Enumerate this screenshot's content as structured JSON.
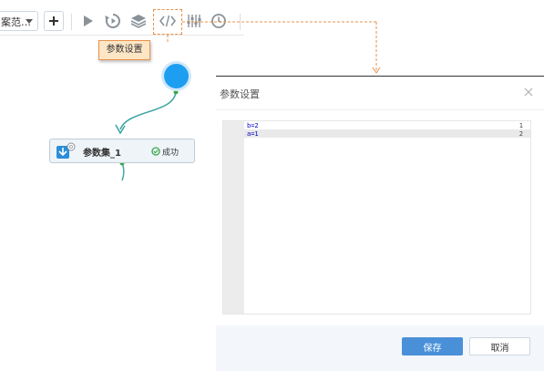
{
  "toolbar": {
    "scheme_select_value": "案范…",
    "icons": [
      "add-icon",
      "run-icon",
      "history-icon",
      "layers-icon",
      "code-icon",
      "sliders-icon",
      "clock-icon"
    ]
  },
  "tooltip": {
    "text": "参数设置"
  },
  "flow": {
    "node_label": "参数集_1",
    "node_status": "成功",
    "colors": {
      "start_node": "#1e9ef0",
      "edge": "#3aa3a3",
      "success": "#3aa64a"
    }
  },
  "dialog": {
    "title": "参数设置",
    "editor_lines": [
      {
        "no": "1",
        "code": "b=2"
      },
      {
        "no": "2",
        "code": "a=1"
      }
    ],
    "save_label": "保存",
    "cancel_label": "取消",
    "accent": "#4a90d9"
  }
}
